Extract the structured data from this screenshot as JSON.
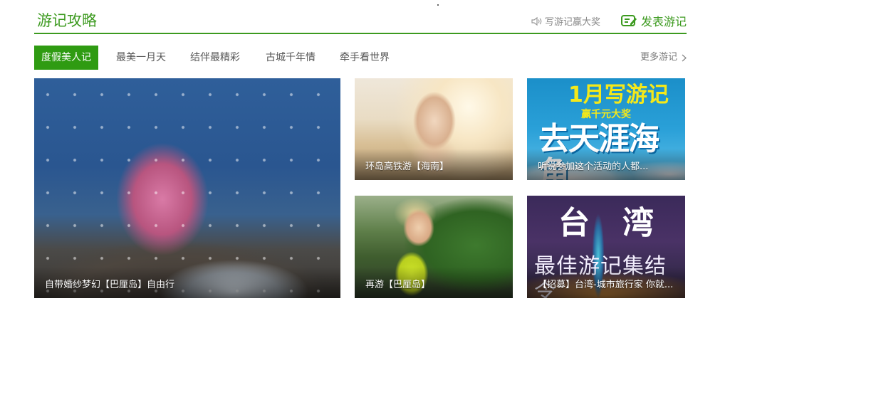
{
  "section": {
    "title": "游记攻略",
    "promo_link": "写游记赢大奖",
    "publish_button": "发表游记",
    "accent_color": "#3c9a1f"
  },
  "tabs": [
    {
      "label": "度假美人记",
      "active": true
    },
    {
      "label": "最美一月天",
      "active": false
    },
    {
      "label": "结伴最精彩",
      "active": false
    },
    {
      "label": "古城千年情",
      "active": false
    },
    {
      "label": "牵手看世界",
      "active": false
    }
  ],
  "more_link": "更多游记",
  "cards": [
    {
      "caption": "自带婚纱梦幻【巴厘岛】自由行"
    },
    {
      "caption": "环岛高铁游【海南】"
    },
    {
      "caption": "听说参加这个活动的人都...",
      "image_text": {
        "month": "1月写游记",
        "prize": "赢千元大奖",
        "big": "去天涯海角"
      }
    },
    {
      "caption": "再游【巴厘岛】"
    },
    {
      "caption": "【招募】台湾-城市旅行家 你就...",
      "image_text": {
        "a": "台",
        "b": "湾",
        "sub": "最佳游记集结令"
      }
    }
  ]
}
